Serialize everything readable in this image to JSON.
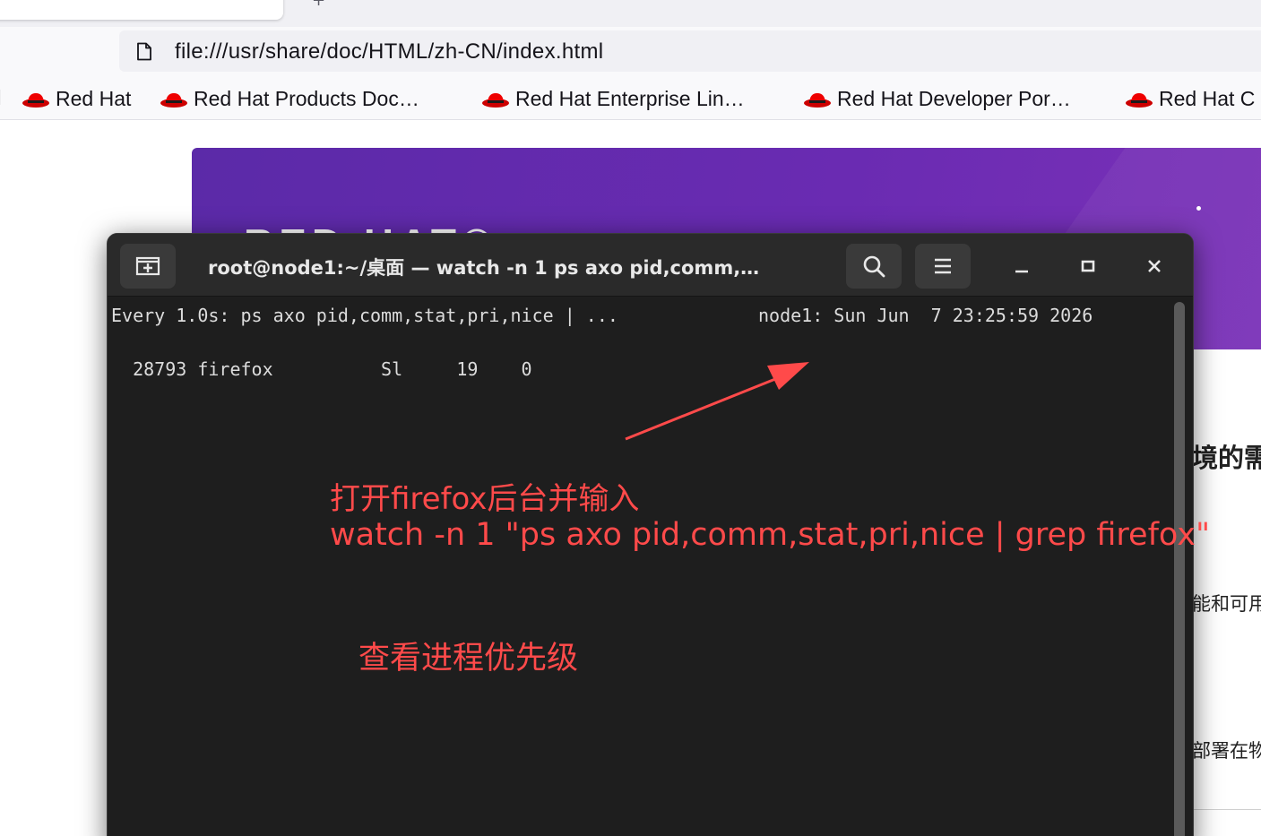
{
  "browser": {
    "url": "file:///usr/share/doc/HTML/zh-CN/index.html",
    "bookmarks": [
      {
        "label": "Red Hat",
        "icon": "redhat-icon"
      },
      {
        "label": "Red Hat Products Doc…",
        "icon": "redhat-icon"
      },
      {
        "label": "Red Hat Enterprise Lin…",
        "icon": "redhat-icon"
      },
      {
        "label": "Red Hat Developer Por…",
        "icon": "redhat-icon"
      },
      {
        "label": "Red Hat C",
        "icon": "redhat-icon"
      }
    ]
  },
  "page": {
    "banner_logo": "RED HAT®",
    "fragment_1": "境的需",
    "fragment_2": "能和可用",
    "fragment_3": "部署在物"
  },
  "terminal": {
    "title": "root@node1:~/桌面 — watch -n 1 ps axo pid,comm,…",
    "header_cmd": "Every 1.0s: ps axo pid,comm,stat,pri,nice | ...",
    "header_host": "node1: Sun Jun  7 23:25:59 2026",
    "process_row": "  28793 firefox          Sl     19    0"
  },
  "annotation": {
    "line1": "打开firefox后台并输入",
    "line2": "watch -n 1 \"ps axo pid,comm,stat,pri,nice | grep firefox\"",
    "line3": "查看进程优先级",
    "color": "#ff4a4a"
  }
}
